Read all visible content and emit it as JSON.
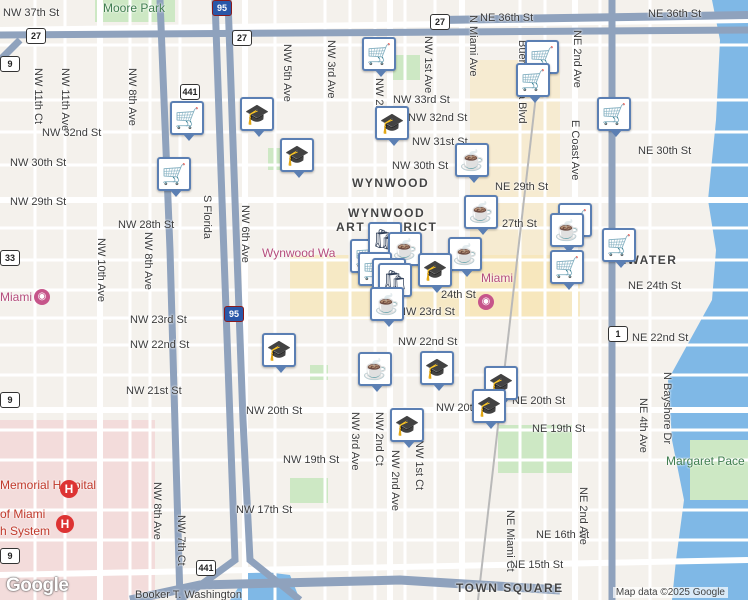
{
  "map": {
    "water_color": "#7fb8e6",
    "park_color": "#cde8c4",
    "highway_color": "#8fa2bd",
    "arterial_color": "#ffffff",
    "district_color": "#f7e6b5",
    "pin_border": "#5b7fb3"
  },
  "labels": {
    "ne36": "NE 36th St",
    "ne36b": "NE 36th St",
    "nw37": "NW 37th St",
    "moore": "Moore Park",
    "nw11ct": "NW 11th Ct",
    "nw11": "NW 11th Ave",
    "nw8": "NW 8th Ave",
    "nw32": "NW 32nd St",
    "nw30": "NW 30th St",
    "nw29": "NW 29th St",
    "nw28": "NW 28th St",
    "nw10": "NW 10th Ave",
    "nw8b": "NW 8th Ave",
    "nw6": "NW 6th Ave",
    "nw5": "NW 5th Ave",
    "nw3": "NW 3rd Ave",
    "nw2": "NW 2nd Ave",
    "nw1": "NW 1st Ave",
    "nmiami": "N Miami Ave",
    "nw33": "NW 33rd St",
    "nw32b": "NW 32nd St",
    "nw31": "NW 31st St",
    "nw30b": "NW 30th St",
    "wynwood": "WYNWOOD",
    "wynart": "WYNWOOD",
    "artdist": "ART DISTRICT",
    "ne29": "NE 29th St",
    "ne27": "27th St",
    "bvb": "Buena Vista Blvd",
    "necoast": "E Coast Ave",
    "ne2": "NE 2nd Ave",
    "ne30": "NE 30th St",
    "wynwall": "Wynwood Wa",
    "miami": "Miami",
    "edge": "EWATER",
    "ne24": "NE 24th St",
    "nw24": "24th St",
    "nw23": "NW 23rd St",
    "nw23b": "NW 23rd St",
    "nw22": "NW 22nd St",
    "nw22b": "NW 22nd St",
    "ne22": "NE 22nd St",
    "nw21": "NW 21st St",
    "nw20": "NW 20th St",
    "nw20b": "NW 20th St",
    "ne20": "NE 20th St",
    "ne19": "NE 19th St",
    "nw19": "NW 19th St",
    "nw17": "NW 17th St",
    "ne16": "NE 16th St",
    "ne15": "NE 15th St",
    "townsq": "TOWN SQUARE",
    "nw3b": "NW 3rd Ave",
    "nw2b": "NW 2nd Ct",
    "nw2c": "NW 2nd Ave",
    "nw1b": "NW 1st Ct",
    "nw8c": "NW 8th Ave",
    "nw7": "NW 7th Ct",
    "nemiami": "NE Miami Ct",
    "ne2b": "NE 2nd Ave",
    "ne4": "NE 4th Ave",
    "bayshore": "N Bayshore Dr",
    "margaret": "Margaret Pace Park",
    "memorial": "Memorial Hospital",
    "ofmiami": "of Miami",
    "system": "h System",
    "mimiami": "Miami",
    "booker": "Booker T. Washington",
    "sfly": "S Florida",
    "n441": "441"
  },
  "shields": {
    "i95": "95",
    "us27a": "27",
    "us27b": "27",
    "us441a": "441",
    "us441b": "441",
    "i95b": "95",
    "us1": "1",
    "s33": "33",
    "s9a": "9",
    "s9b": "9",
    "s9c": "9"
  },
  "pins": [
    {
      "type": "shopping-cart",
      "glyph": "🛒"
    },
    {
      "type": "shopping-cart",
      "glyph": "🛒"
    },
    {
      "type": "shopping-cart",
      "glyph": "🛒"
    },
    {
      "type": "shopping-cart",
      "glyph": "🛒"
    },
    {
      "type": "shopping-cart",
      "glyph": "🛒"
    },
    {
      "type": "shopping-cart",
      "glyph": "🛒"
    },
    {
      "type": "school",
      "glyph": "🎓"
    },
    {
      "type": "school",
      "glyph": "🎓"
    },
    {
      "type": "school",
      "glyph": "🎓"
    },
    {
      "type": "coffee",
      "glyph": "☕"
    },
    {
      "type": "coffee",
      "glyph": "☕"
    },
    {
      "type": "shopping-cart",
      "glyph": "🛒"
    },
    {
      "type": "coffee",
      "glyph": "☕"
    },
    {
      "type": "shopping-cart",
      "glyph": "🛒"
    },
    {
      "type": "shopping-cart",
      "glyph": "🛒"
    },
    {
      "type": "coffee",
      "glyph": "☕"
    },
    {
      "type": "shopping-bag",
      "glyph": "🛍"
    },
    {
      "type": "school",
      "glyph": "🎓"
    },
    {
      "type": "coffee",
      "glyph": "☕"
    },
    {
      "type": "school",
      "glyph": "🎓"
    },
    {
      "type": "coffee",
      "glyph": "☕"
    },
    {
      "type": "school",
      "glyph": "🎓"
    },
    {
      "type": "school",
      "glyph": "🎓"
    },
    {
      "type": "school",
      "glyph": "🎓"
    },
    {
      "type": "school",
      "glyph": "🎓"
    },
    {
      "type": "shopping-cart",
      "glyph": "🛒"
    },
    {
      "type": "coffee",
      "glyph": "☕"
    }
  ],
  "attribution": {
    "logo": "Google",
    "credit": "Map data ©2025 Google"
  }
}
